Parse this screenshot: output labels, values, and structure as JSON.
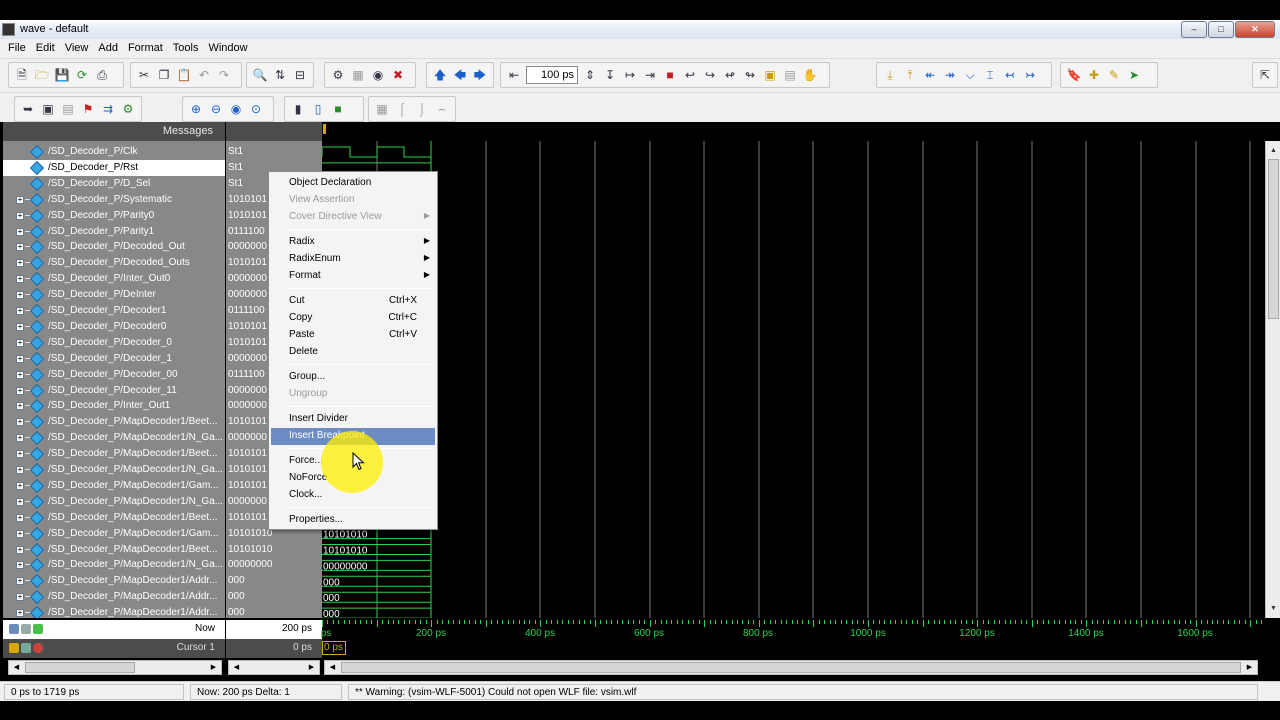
{
  "window": {
    "title": "wave - default",
    "minimize": "0",
    "maximize": "1",
    "close": "r"
  },
  "menus": [
    "File",
    "Edit",
    "View",
    "Add",
    "Format",
    "Tools",
    "Window"
  ],
  "toolbar": {
    "time_step": "100 ps"
  },
  "panes": {
    "messages_header": "Messages"
  },
  "signals": [
    {
      "name": "/SD_Decoder_P/Clk",
      "value": "St1",
      "bus": false,
      "selected": false
    },
    {
      "name": "/SD_Decoder_P/Rst",
      "value": "St1",
      "bus": false,
      "selected": true
    },
    {
      "name": "/SD_Decoder_P/D_Sel",
      "value": "St1",
      "bus": false,
      "selected": false
    },
    {
      "name": "/SD_Decoder_P/Systematic",
      "value": "1010101",
      "bus": true
    },
    {
      "name": "/SD_Decoder_P/Parity0",
      "value": "1010101",
      "bus": true
    },
    {
      "name": "/SD_Decoder_P/Parity1",
      "value": "0111100",
      "bus": true
    },
    {
      "name": "/SD_Decoder_P/Decoded_Out",
      "value": "0000000",
      "bus": true
    },
    {
      "name": "/SD_Decoder_P/Decoded_Outs",
      "value": "1010101",
      "bus": true
    },
    {
      "name": "/SD_Decoder_P/Inter_Out0",
      "value": "0000000",
      "bus": true
    },
    {
      "name": "/SD_Decoder_P/DeInter",
      "value": "0000000",
      "bus": true
    },
    {
      "name": "/SD_Decoder_P/Decoder1",
      "value": "0111100",
      "bus": true
    },
    {
      "name": "/SD_Decoder_P/Decoder0",
      "value": "1010101",
      "bus": true
    },
    {
      "name": "/SD_Decoder_P/Decoder_0",
      "value": "1010101",
      "bus": true
    },
    {
      "name": "/SD_Decoder_P/Decoder_1",
      "value": "0000000",
      "bus": true
    },
    {
      "name": "/SD_Decoder_P/Decoder_00",
      "value": "0111100",
      "bus": true
    },
    {
      "name": "/SD_Decoder_P/Decoder_11",
      "value": "0000000",
      "bus": true
    },
    {
      "name": "/SD_Decoder_P/Inter_Out1",
      "value": "0000000",
      "bus": true
    },
    {
      "name": "/SD_Decoder_P/MapDecoder1/Beet...",
      "value": "1010101",
      "bus": true
    },
    {
      "name": "/SD_Decoder_P/MapDecoder1/N_Ga...",
      "value": "0000000",
      "bus": true
    },
    {
      "name": "/SD_Decoder_P/MapDecoder1/Beet...",
      "value": "1010101",
      "bus": true
    },
    {
      "name": "/SD_Decoder_P/MapDecoder1/N_Ga...",
      "value": "1010101",
      "bus": true
    },
    {
      "name": "/SD_Decoder_P/MapDecoder1/Gam...",
      "value": "1010101",
      "bus": true
    },
    {
      "name": "/SD_Decoder_P/MapDecoder1/N_Ga...",
      "value": "0000000",
      "bus": true
    },
    {
      "name": "/SD_Decoder_P/MapDecoder1/Beet...",
      "value": "1010101",
      "bus": true
    },
    {
      "name": "/SD_Decoder_P/MapDecoder1/Gam...",
      "value": "10101010",
      "bus": true,
      "wave_label": "10101010"
    },
    {
      "name": "/SD_Decoder_P/MapDecoder1/Beet...",
      "value": "10101010",
      "bus": true,
      "wave_label": "10101010"
    },
    {
      "name": "/SD_Decoder_P/MapDecoder1/N_Ga...",
      "value": "00000000",
      "bus": true,
      "wave_label": "00000000"
    },
    {
      "name": "/SD_Decoder_P/MapDecoder1/Addr...",
      "value": "000",
      "bus": true,
      "wave_label": "000"
    },
    {
      "name": "/SD_Decoder_P/MapDecoder1/Addr...",
      "value": "000",
      "bus": true,
      "wave_label": "000"
    },
    {
      "name": "/SD_Decoder_P/MapDecoder1/Addr...",
      "value": "000",
      "bus": true,
      "wave_label": "000"
    }
  ],
  "context_menu": [
    {
      "label": "Object Declaration",
      "enabled": true
    },
    {
      "label": "View Assertion",
      "enabled": false
    },
    {
      "label": "Cover Directive View",
      "enabled": false,
      "submenu": true
    },
    {
      "sep": true
    },
    {
      "label": "Radix",
      "enabled": true,
      "submenu": true
    },
    {
      "label": "RadixEnum",
      "enabled": true,
      "submenu": true
    },
    {
      "label": "Format",
      "enabled": true,
      "submenu": true
    },
    {
      "sep": true
    },
    {
      "label": "Cut",
      "enabled": true,
      "shortcut": "Ctrl+X"
    },
    {
      "label": "Copy",
      "enabled": true,
      "shortcut": "Ctrl+C"
    },
    {
      "label": "Paste",
      "enabled": true,
      "shortcut": "Ctrl+V"
    },
    {
      "label": "Delete",
      "enabled": true
    },
    {
      "sep": true
    },
    {
      "label": "Group...",
      "enabled": true
    },
    {
      "label": "Ungroup",
      "enabled": false
    },
    {
      "sep": true
    },
    {
      "label": "Insert Divider",
      "enabled": true
    },
    {
      "label": "Insert Breakpoint",
      "enabled": true,
      "highlighted": true
    },
    {
      "sep": true
    },
    {
      "label": "Force...",
      "enabled": true
    },
    {
      "label": "NoForce",
      "enabled": true
    },
    {
      "label": "Clock...",
      "enabled": true
    },
    {
      "sep": true
    },
    {
      "label": "Properties...",
      "enabled": true
    }
  ],
  "cursor_panel": {
    "now_label": "Now",
    "now_value": "200 ps",
    "cursor_label": "Cursor 1",
    "cursor_value": "0 ps",
    "cursor_time": "0 ps"
  },
  "ruler": {
    "partial_first": "ps",
    "labels": [
      "200 ps",
      "400 ps",
      "600 ps",
      "800 ps",
      "1000 ps",
      "1200 ps",
      "1400 ps",
      "1600 ps"
    ]
  },
  "status": {
    "range": "0 ps to 1719 ps",
    "now_delta": "Now: 200 ps  Delta: 1",
    "message": "** Warning: (vsim-WLF-5001) Could not open WLF file: vsim.wlf"
  },
  "colors": {
    "wave": "#2bd44a",
    "cursor": "#d4a800",
    "signal_icon": "#38a6e0",
    "menu_highlight": "#6e8cc4",
    "click_highlight": "#ffee00"
  }
}
